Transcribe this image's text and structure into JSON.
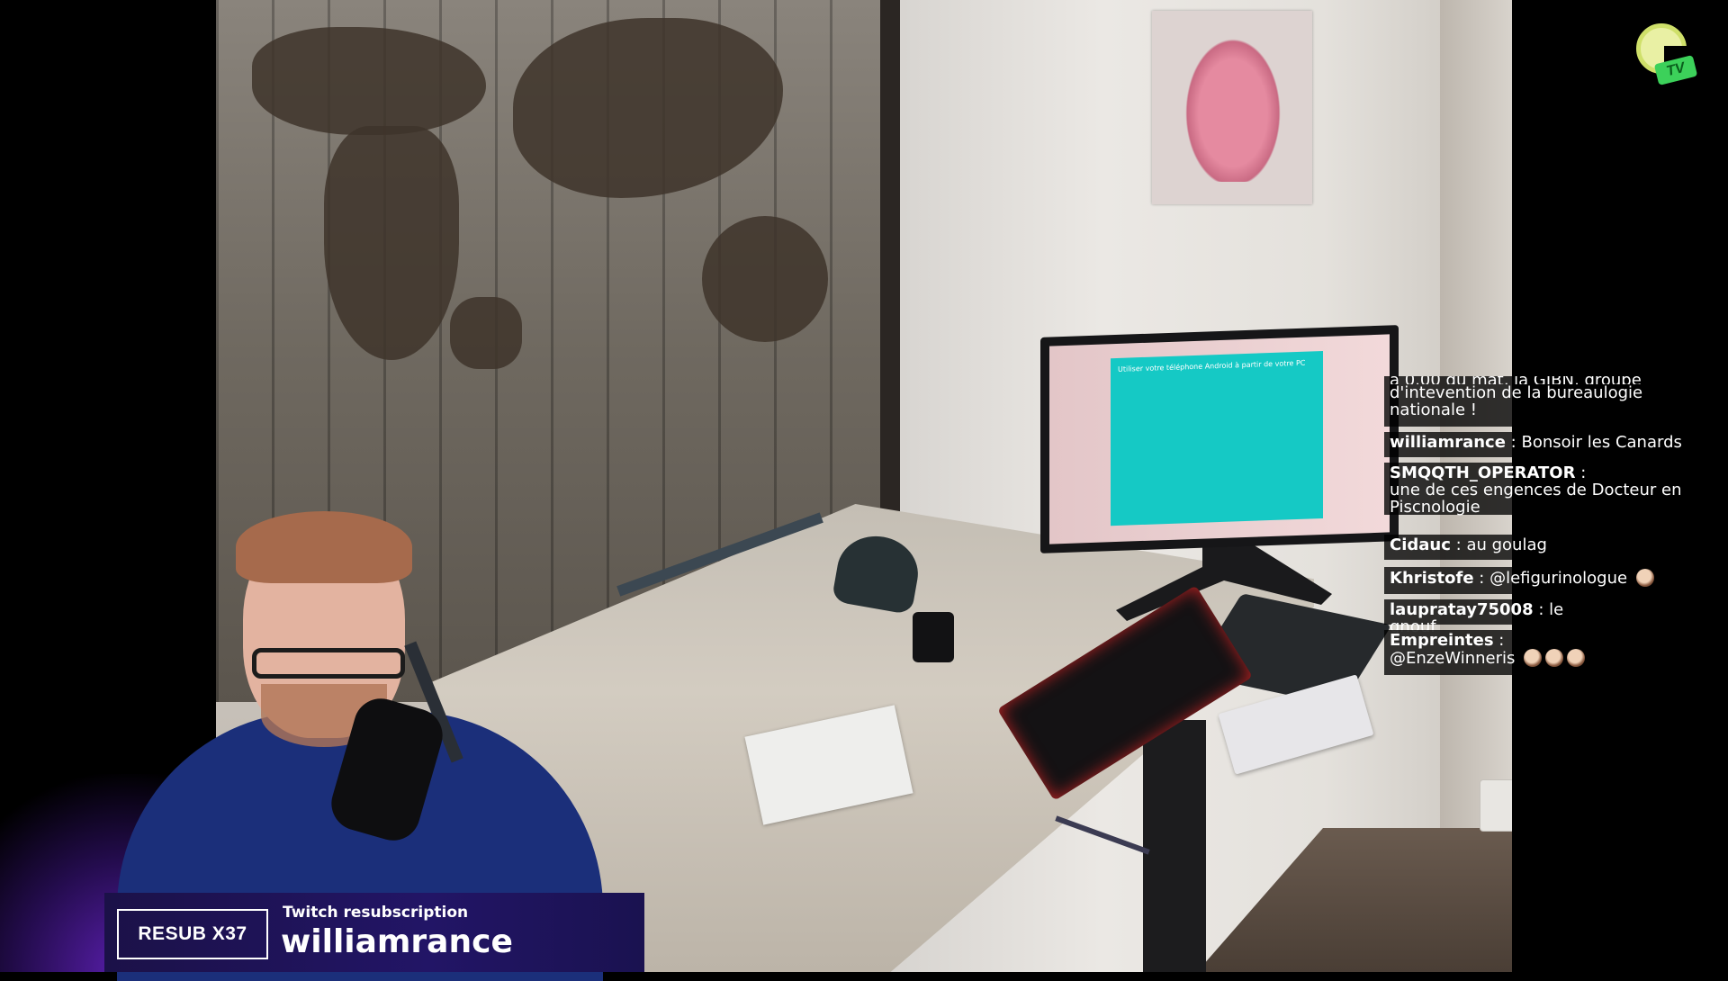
{
  "chat": {
    "messages": [
      {
        "user": "",
        "text": "d'intevention de la bureaulogie nationale !",
        "partial_top": "à 0.00 du mat, la GIBN, groupe"
      },
      {
        "user": "williamrance",
        "text": "Bonsoir les Canards"
      },
      {
        "user": "SMQQTH_OPERATOR",
        "text": "une de ces engences de Docteur en Piscnologie"
      },
      {
        "user": "Cidauc",
        "text": "au goulag"
      },
      {
        "user": "Khristofe",
        "text": "@lefigurinologue"
      },
      {
        "user": "laupratay75008",
        "text": "le gnouf"
      },
      {
        "user": "Empreintes",
        "text": "@EnzeWinneris"
      }
    ],
    "separator": ":"
  },
  "alert": {
    "badge": "RESUB X37",
    "title": "Twitch resubscription",
    "username": "williamrance",
    "colors": {
      "background": "#221566",
      "text": "#ffffff"
    }
  },
  "logo": {
    "letter": "G",
    "sub": "TV",
    "icon": "channel-logo"
  },
  "screen": {
    "heading": "Utiliser votre téléphone Android à partir de votre PC"
  },
  "icons": [
    "channel-logo-icon",
    "emote-icon"
  ]
}
